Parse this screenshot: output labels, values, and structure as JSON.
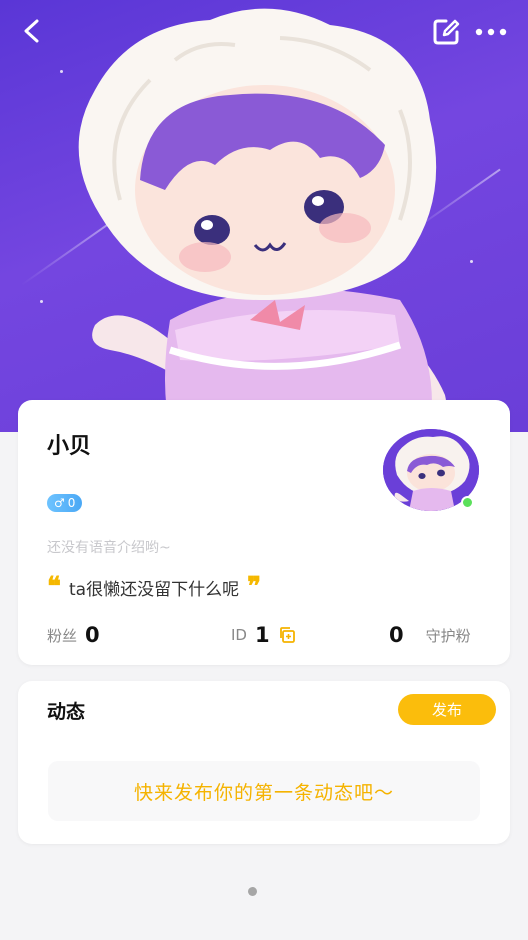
{
  "header": {
    "back_icon": "chevron-left-icon",
    "edit_icon": "edit-icon",
    "more_icon": "more-horizontal-icon"
  },
  "profile": {
    "username": "小贝",
    "gender_symbol": "♂",
    "gender_count": "0",
    "voice_intro": "还没有语音介绍哟~",
    "quote_open": "❝",
    "quote_text": "ta很懒还没留下什么呢",
    "quote_close": "❞",
    "stats": {
      "fans_label": "粉丝",
      "fans_value": "0",
      "id_label": "ID",
      "id_value": "1",
      "guard_value": "0",
      "guard_label": "守护粉"
    }
  },
  "feed": {
    "title": "动态",
    "publish_label": "发布",
    "empty_text": "快来发布你的第一条动态吧～"
  },
  "colors": {
    "hero_purple": "#6a3ed8",
    "accent_yellow": "#fbbd0c",
    "gender_blue": "#4aa8f5",
    "online_green": "#5be05b"
  }
}
